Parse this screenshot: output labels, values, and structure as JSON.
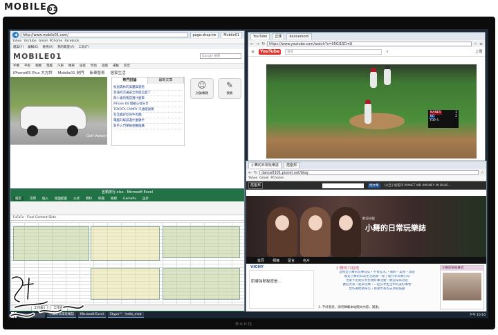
{
  "watermark": {
    "text": "MOBILE",
    "suffix": "01"
  },
  "monitor": {
    "brand": "BenQ"
  },
  "ie": {
    "tabs": [
      "Mobile01",
      "page.shop.tw",
      "Mobile01"
    ],
    "url": "http://www.mobile01.com/",
    "favorites": [
      "Yahoo",
      "YouTube",
      "Gmail",
      "PChome",
      "Facebook"
    ],
    "menu": [
      "檔案(F)",
      "編輯(E)",
      "檢視(V)",
      "我的最愛(A)",
      "工具(T)"
    ],
    "logo": "MOBILE01",
    "search_placeholder": "Google 搜尋",
    "nav": [
      "手機",
      "平板",
      "相機",
      "電腦",
      "汽車",
      "機車",
      "居家",
      "時尚",
      "遊戲",
      "運動",
      "影音"
    ],
    "section": [
      "iPhone6S Plus 大方評",
      "Mobile01 熱門",
      "新車發表",
      "居家生活"
    ],
    "hot_tabs": [
      "熱門討論",
      "最新文章"
    ],
    "hot_items": [
      "松鼠森林的美麗與哀愁",
      "台灣的交通安全到底怎麼了",
      "四十歲的我該買什麼車",
      "iPhone 6S 開箱心得分享",
      "TOYOTA CAMRY 汽油版試駕",
      "台北最好吃的牛肉麵",
      "電腦升級該選什麼顯卡",
      "新手入門單眼相機推薦"
    ],
    "side_icons": [
      "討論專題",
      "我要"
    ],
    "car_caption": "Golf Variant"
  },
  "youtube": {
    "tabs": [
      "YouTube",
      "正妹",
      "danceroom"
    ],
    "url": "https://www.youtube.com/watch?v=Ii5Gi1SCmU",
    "logo": "YouTube",
    "search_placeholder": "搜尋",
    "upload_label": "上傳",
    "scoreboard": {
      "team_a": "NANES",
      "team_b": "KC",
      "score_a": "1",
      "score_b": "2",
      "inning": "TOP 5"
    }
  },
  "excel": {
    "title": "各類排行.xlsx - Microsoft Excel",
    "tabs": [
      "檔案",
      "常用",
      "插入",
      "版面配置",
      "公式",
      "資料",
      "校閱",
      "檢視",
      "Gamefix",
      "設計"
    ],
    "formula": "FuFuFu - Final Content Slide",
    "sheets": [
      "工作表1",
      "工作表2"
    ]
  },
  "blog": {
    "tabs": [
      "小舞的日常玩樂誌",
      "痞客邦"
    ],
    "url": "dance0101.pixnet.net/blog",
    "logo": "痞客邦",
    "header_btn": "找文章",
    "crumb": "[公告] 痞客邦 PIXNET MB (MONEY IN BLOG...",
    "banner_title": "小舞的日常玩樂誌",
    "banner_sub": "歡迎光臨",
    "nav": [
      "首頁",
      "相簿",
      "留言",
      "名片"
    ],
    "vichy": "VICHY",
    "ad_text": "肌膚強韌秘密是...",
    "post_title": "小舞的介紹唷",
    "post_lines": [
      "這裡是小舞的玩樂日誌・不管是3C・服飾・美食・旅遊",
      "都是小舞的日常生活點滴・除了會分享玩樂心得",
      "也會不定期分享各種好康活動・歡迎常來逛逛",
      "歡迎大家一起來玩樂・一起分享生活中的美好事物",
      "合作邀約請來信・感謝大家的支持與鼓勵"
    ],
    "bottom": "1. 不好意思，請勿轉載本站圖文內容，謝謝。",
    "sidebar_title": "小舞的粉絲專頁"
  },
  "taskbar": {
    "items": [
      "小舞的日常玩樂誌",
      "Microsoft Excel",
      "Skype™ - hello_mob",
      ""
    ],
    "clock": "下午 10:16"
  }
}
